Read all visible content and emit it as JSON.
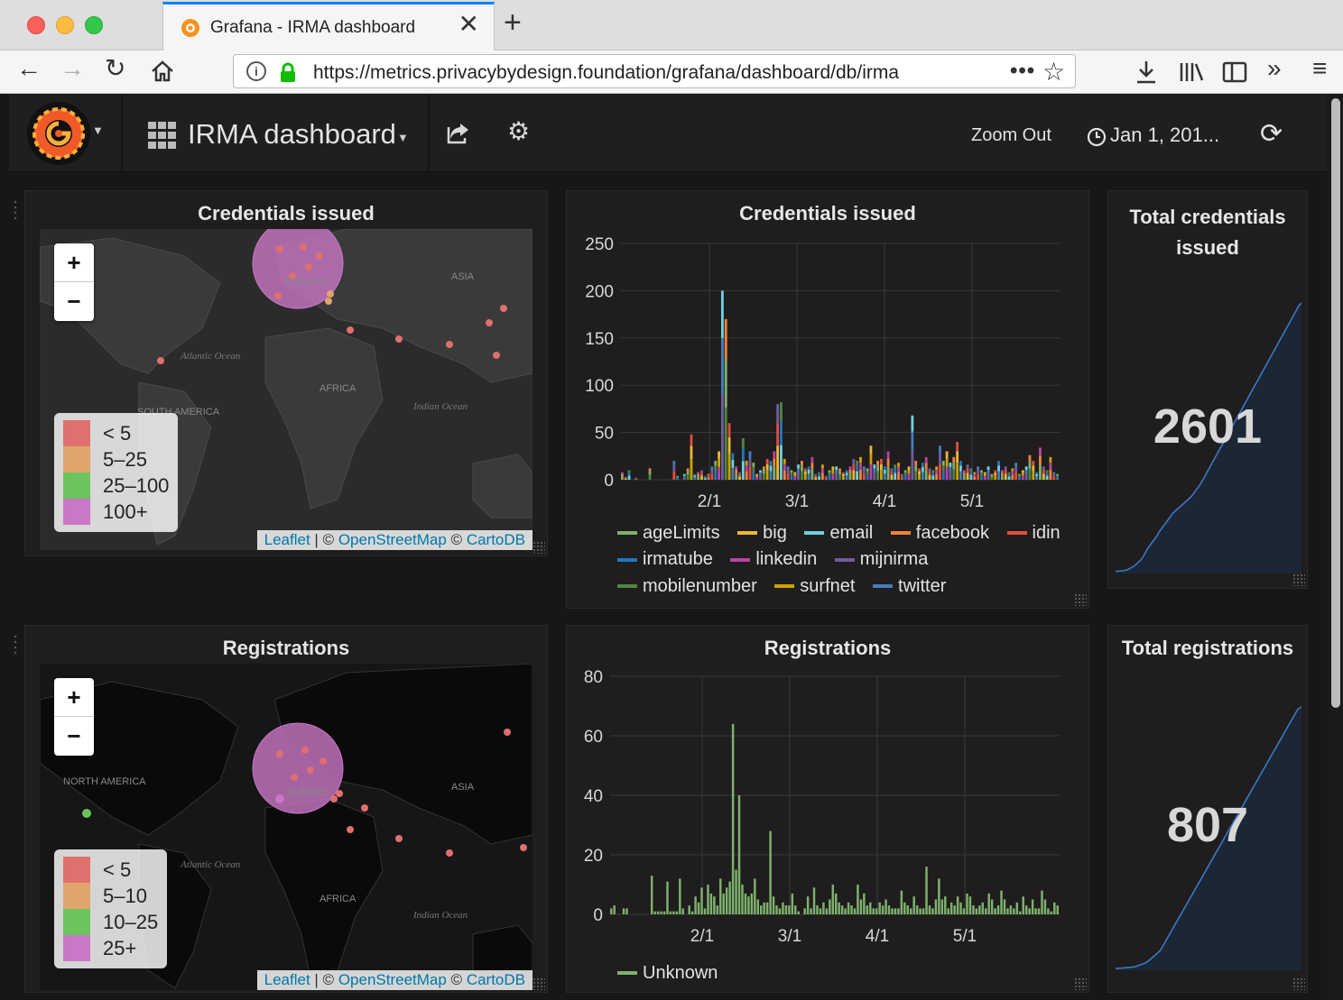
{
  "browser": {
    "tab_title": "Grafana - IRMA dashboard",
    "url": "https://metrics.privacybydesign.foundation/grafana/dashboard/db/irma",
    "new_tab_label": "+",
    "close_label": "✕"
  },
  "header": {
    "dashboard_title": "IRMA dashboard",
    "zoom_out": "Zoom Out",
    "time_range": "Jan 1, 201..."
  },
  "panels": {
    "cred_map": {
      "title": "Credentials issued",
      "legend": [
        {
          "label": "< 5",
          "color": "#e0706d"
        },
        {
          "label": "5–25",
          "color": "#e0a56c"
        },
        {
          "label": "25–100",
          "color": "#6cc45c"
        },
        {
          "label": "100+",
          "color": "#c977c6"
        }
      ],
      "labels": {
        "europe": "EUROPE",
        "asia": "ASIA",
        "africa": "AFRICA",
        "atlantic": "Atlantic Ocean",
        "indian": "Indian Ocean",
        "south_america": "SOUTH AMERICA"
      },
      "attribution": {
        "leaflet": "Leaflet",
        "osm": "OpenStreetMap",
        "carto": "CartoDB",
        "sep": " | © ",
        "sep2": " © "
      }
    },
    "cred_chart": {
      "title": "Credentials issued",
      "legend": [
        {
          "label": "ageLimits",
          "color": "#7eb26d"
        },
        {
          "label": "big",
          "color": "#eab839"
        },
        {
          "label": "email",
          "color": "#6ed0e0"
        },
        {
          "label": "facebook",
          "color": "#ef843c"
        },
        {
          "label": "idin",
          "color": "#e24d42"
        },
        {
          "label": "irmatube",
          "color": "#1f78c1"
        },
        {
          "label": "linkedin",
          "color": "#ba43a9"
        },
        {
          "label": "mijnirma",
          "color": "#705da0"
        },
        {
          "label": "mobilenumber",
          "color": "#508642"
        },
        {
          "label": "surfnet",
          "color": "#cca300"
        },
        {
          "label": "twitter",
          "color": "#447ebc"
        }
      ]
    },
    "cred_total": {
      "title": "Total credentials issued",
      "value": "2601"
    },
    "reg_map": {
      "title": "Registrations",
      "legend": [
        {
          "label": "< 5",
          "color": "#e0706d"
        },
        {
          "label": "5–10",
          "color": "#e0a56c"
        },
        {
          "label": "10–25",
          "color": "#6cc45c"
        },
        {
          "label": "25+",
          "color": "#c977c6"
        }
      ],
      "labels": {
        "europe": "EUROPE",
        "asia": "ASIA",
        "africa": "AFRICA",
        "atlantic": "Atlantic Ocean",
        "indian": "Indian Ocean",
        "north_america": "NORTH AMERICA"
      },
      "attribution": {
        "leaflet": "Leaflet",
        "osm": "OpenStreetMap",
        "carto": "CartoDB",
        "sep": " | © ",
        "sep2": " © "
      }
    },
    "reg_chart": {
      "title": "Registrations",
      "legend": [
        {
          "label": "Unknown",
          "color": "#7eb26d"
        }
      ]
    },
    "reg_total": {
      "title": "Total registrations",
      "value": "807"
    }
  },
  "chart_data": [
    {
      "type": "bar",
      "title": "Credentials issued",
      "x_ticks": [
        "2/1",
        "3/1",
        "4/1",
        "5/1"
      ],
      "y_ticks": [
        0,
        50,
        100,
        150,
        200,
        250
      ],
      "ylim": [
        0,
        250
      ],
      "stacked": true,
      "totals": [
        8,
        3,
        10,
        0,
        2,
        0,
        0,
        0,
        12,
        0,
        0,
        0,
        0,
        0,
        0,
        20,
        4,
        0,
        6,
        12,
        48,
        6,
        8,
        10,
        4,
        6,
        14,
        20,
        30,
        200,
        170,
        60,
        28,
        14,
        8,
        44,
        20,
        30,
        18,
        6,
        10,
        14,
        22,
        20,
        30,
        80,
        82,
        22,
        14,
        10,
        8,
        16,
        20,
        12,
        14,
        24,
        6,
        8,
        16,
        4,
        10,
        14,
        14,
        12,
        8,
        10,
        14,
        22,
        20,
        24,
        14,
        12,
        36,
        16,
        20,
        22,
        14,
        30,
        12,
        16,
        18,
        6,
        10,
        14,
        68,
        20,
        12,
        18,
        24,
        12,
        10,
        14,
        36,
        20,
        30,
        18,
        24,
        40,
        20,
        10,
        16,
        12,
        8,
        14,
        10,
        8,
        14,
        6,
        10,
        20,
        10,
        14,
        8,
        12,
        18,
        6,
        10,
        14,
        26,
        20,
        8,
        34,
        14,
        10,
        24,
        8,
        6
      ]
    },
    {
      "type": "bar",
      "title": "Registrations",
      "x_ticks": [
        "2/1",
        "3/1",
        "4/1",
        "5/1"
      ],
      "y_ticks": [
        0,
        20,
        40,
        60,
        80
      ],
      "ylim": [
        0,
        80
      ],
      "series": [
        {
          "name": "Unknown",
          "values": [
            2,
            3,
            0,
            0,
            2,
            2,
            0,
            0,
            0,
            0,
            0,
            0,
            0,
            13,
            1,
            1,
            1,
            1,
            11,
            1,
            1,
            1,
            12,
            2,
            0,
            3,
            1,
            6,
            4,
            9,
            2,
            10,
            7,
            6,
            3,
            12,
            7,
            9,
            11,
            64,
            15,
            40,
            10,
            7,
            6,
            7,
            12,
            5,
            3,
            4,
            4,
            28,
            6,
            3,
            2,
            4,
            3,
            3,
            7,
            3,
            1,
            0,
            2,
            6,
            2,
            9,
            3,
            2,
            4,
            2,
            5,
            10,
            7,
            4,
            3,
            2,
            4,
            3,
            2,
            10,
            5,
            7,
            3,
            4,
            2,
            2,
            4,
            3,
            5,
            3,
            2,
            2,
            2,
            8,
            4,
            3,
            2,
            6,
            3,
            2,
            2,
            16,
            3,
            2,
            5,
            12,
            5,
            6,
            2,
            4,
            3,
            6,
            4,
            2,
            7,
            6,
            3,
            2,
            3,
            4,
            2,
            7,
            5,
            2,
            3,
            8,
            5,
            2,
            3,
            2,
            4,
            1,
            6,
            3,
            2,
            5,
            2,
            2,
            8,
            5,
            2,
            1,
            4,
            3
          ]
        }
      ]
    },
    {
      "type": "area",
      "title": "Total credentials issued",
      "series": [
        {
          "name": "Total credentials issued",
          "values": [
            20,
            22,
            24,
            26,
            30,
            34,
            46,
            58,
            70,
            88,
            110,
            130,
            160,
            200,
            240,
            270,
            300,
            330,
            360,
            400,
            430,
            460,
            490,
            520,
            550,
            580,
            600,
            620,
            640,
            660,
            680,
            700,
            720,
            740,
            770,
            800,
            830,
            860,
            900,
            940,
            980,
            1020,
            1060,
            1100,
            1140,
            1180,
            1220,
            1260,
            1300,
            1340,
            1380,
            1420,
            1460,
            1500,
            1540,
            1580,
            1620,
            1660,
            1700,
            1740,
            1780,
            1820,
            1860,
            1900,
            1940,
            1980,
            2020,
            2060,
            2100,
            2140,
            2180,
            2220,
            2260,
            2300,
            2340,
            2380,
            2420,
            2460,
            2500,
            2540,
            2580,
            2601
          ]
        }
      ]
    },
    {
      "type": "area",
      "title": "Total registrations",
      "series": [
        {
          "name": "Total registrations",
          "values": [
            5,
            6,
            7,
            8,
            9,
            10,
            14,
            18,
            22,
            30,
            40,
            50,
            60,
            80,
            100,
            120,
            140,
            160,
            180,
            200,
            220,
            240,
            260,
            280,
            300,
            320,
            340,
            360,
            380,
            400,
            420,
            440,
            460,
            480,
            500,
            520,
            540,
            560,
            580,
            600,
            620,
            640,
            660,
            680,
            700,
            720,
            740,
            760,
            780,
            800,
            807
          ]
        }
      ]
    }
  ]
}
